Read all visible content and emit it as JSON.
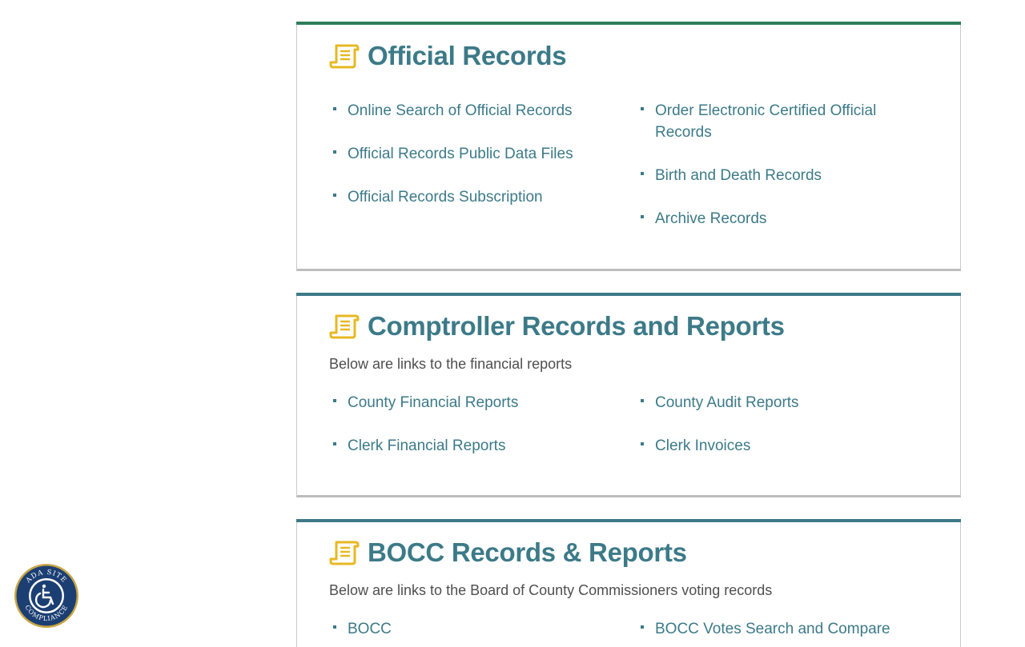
{
  "colors": {
    "teal": "#3c7a88",
    "green_bar": "#2e7d5b",
    "gold_icon": "#e7b822",
    "text_gray": "#4f4f4f"
  },
  "sections": [
    {
      "title": "Official Records",
      "icon": "scroll-icon",
      "links_left": [
        "Online Search of Official Records",
        "Official Records Public Data Files",
        "Official Records Subscription"
      ],
      "links_right": [
        "Order Electronic Certified Official Records",
        "Birth and Death Records",
        "Archive Records"
      ]
    },
    {
      "title": "Comptroller Records and Reports",
      "icon": "scroll-icon",
      "description": "Below are links to the financial reports",
      "links_left": [
        "County Financial Reports",
        "Clerk Financial Reports"
      ],
      "links_right": [
        "County Audit Reports",
        "Clerk Invoices"
      ]
    },
    {
      "title": "BOCC Records & Reports",
      "icon": "scroll-icon",
      "description": "Below are links to the Board of County Commissioners voting records",
      "links_left": [
        "BOCC"
      ],
      "links_right": [
        "BOCC Votes Search and Compare"
      ]
    }
  ],
  "ada_badge": {
    "icon": "wheelchair-icon",
    "text": "ADA SITE COMPLIANCE"
  }
}
